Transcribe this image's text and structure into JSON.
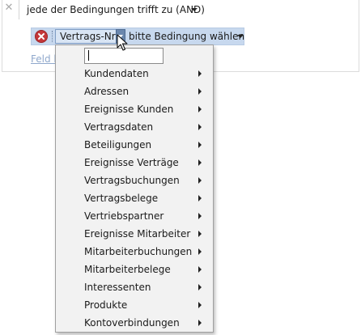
{
  "filter": {
    "condition_mode_label": "jede der Bedingungen trifft zu (AND)",
    "condition": {
      "field_label": "Vertrags-Nr",
      "operator_placeholder": "bitte Bedingung wählen"
    },
    "add_field_link": "Feld hinzufügen"
  },
  "menu": {
    "search_value": "",
    "items": [
      {
        "label": "Kundendaten"
      },
      {
        "label": "Adressen"
      },
      {
        "label": "Ereignisse Kunden"
      },
      {
        "label": "Vertragsdaten"
      },
      {
        "label": "Beteiligungen"
      },
      {
        "label": "Ereignisse Verträge"
      },
      {
        "label": "Vertragsbuchungen"
      },
      {
        "label": "Vertragsbelege"
      },
      {
        "label": "Vertriebspartner"
      },
      {
        "label": "Ereignisse Mitarbeiter"
      },
      {
        "label": "Mitarbeiterbuchungen"
      },
      {
        "label": "Mitarbeiterbelege"
      },
      {
        "label": "Interessenten"
      },
      {
        "label": "Produkte"
      },
      {
        "label": "Kontoverbindungen"
      }
    ]
  },
  "colors": {
    "condition_row_bg": "#c7d8ee",
    "remove_icon": "#c4373a",
    "link": "#8fa8cc",
    "menu_bg": "#f2f2f2"
  },
  "icons": {
    "close": "close-icon",
    "remove": "remove-condition-icon",
    "dropdown": "chevron-down-icon",
    "submenu": "chevron-right-icon",
    "cursor": "mouse-pointer-icon"
  }
}
